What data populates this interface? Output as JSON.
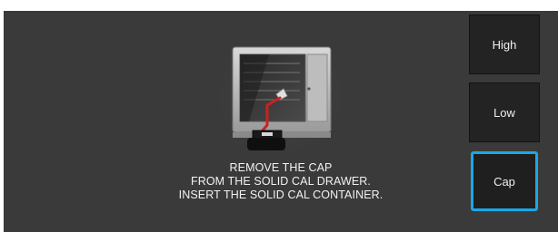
{
  "instruction": {
    "line1": "REMOVE THE CAP",
    "line2": "FROM THE SOLID CAL DRAWER.",
    "line3": "INSERT THE SOLID CAL CONTAINER."
  },
  "buttons": {
    "high": "High",
    "low": "Low",
    "cap": "Cap"
  },
  "selected_button": "Cap",
  "colors": {
    "background": "#3a3a3a",
    "button": "#232323",
    "selected_border": "#1aa8e6",
    "tube": "#cc2020"
  },
  "illustration": {
    "icon": "oven-with-cal-container-icon"
  }
}
